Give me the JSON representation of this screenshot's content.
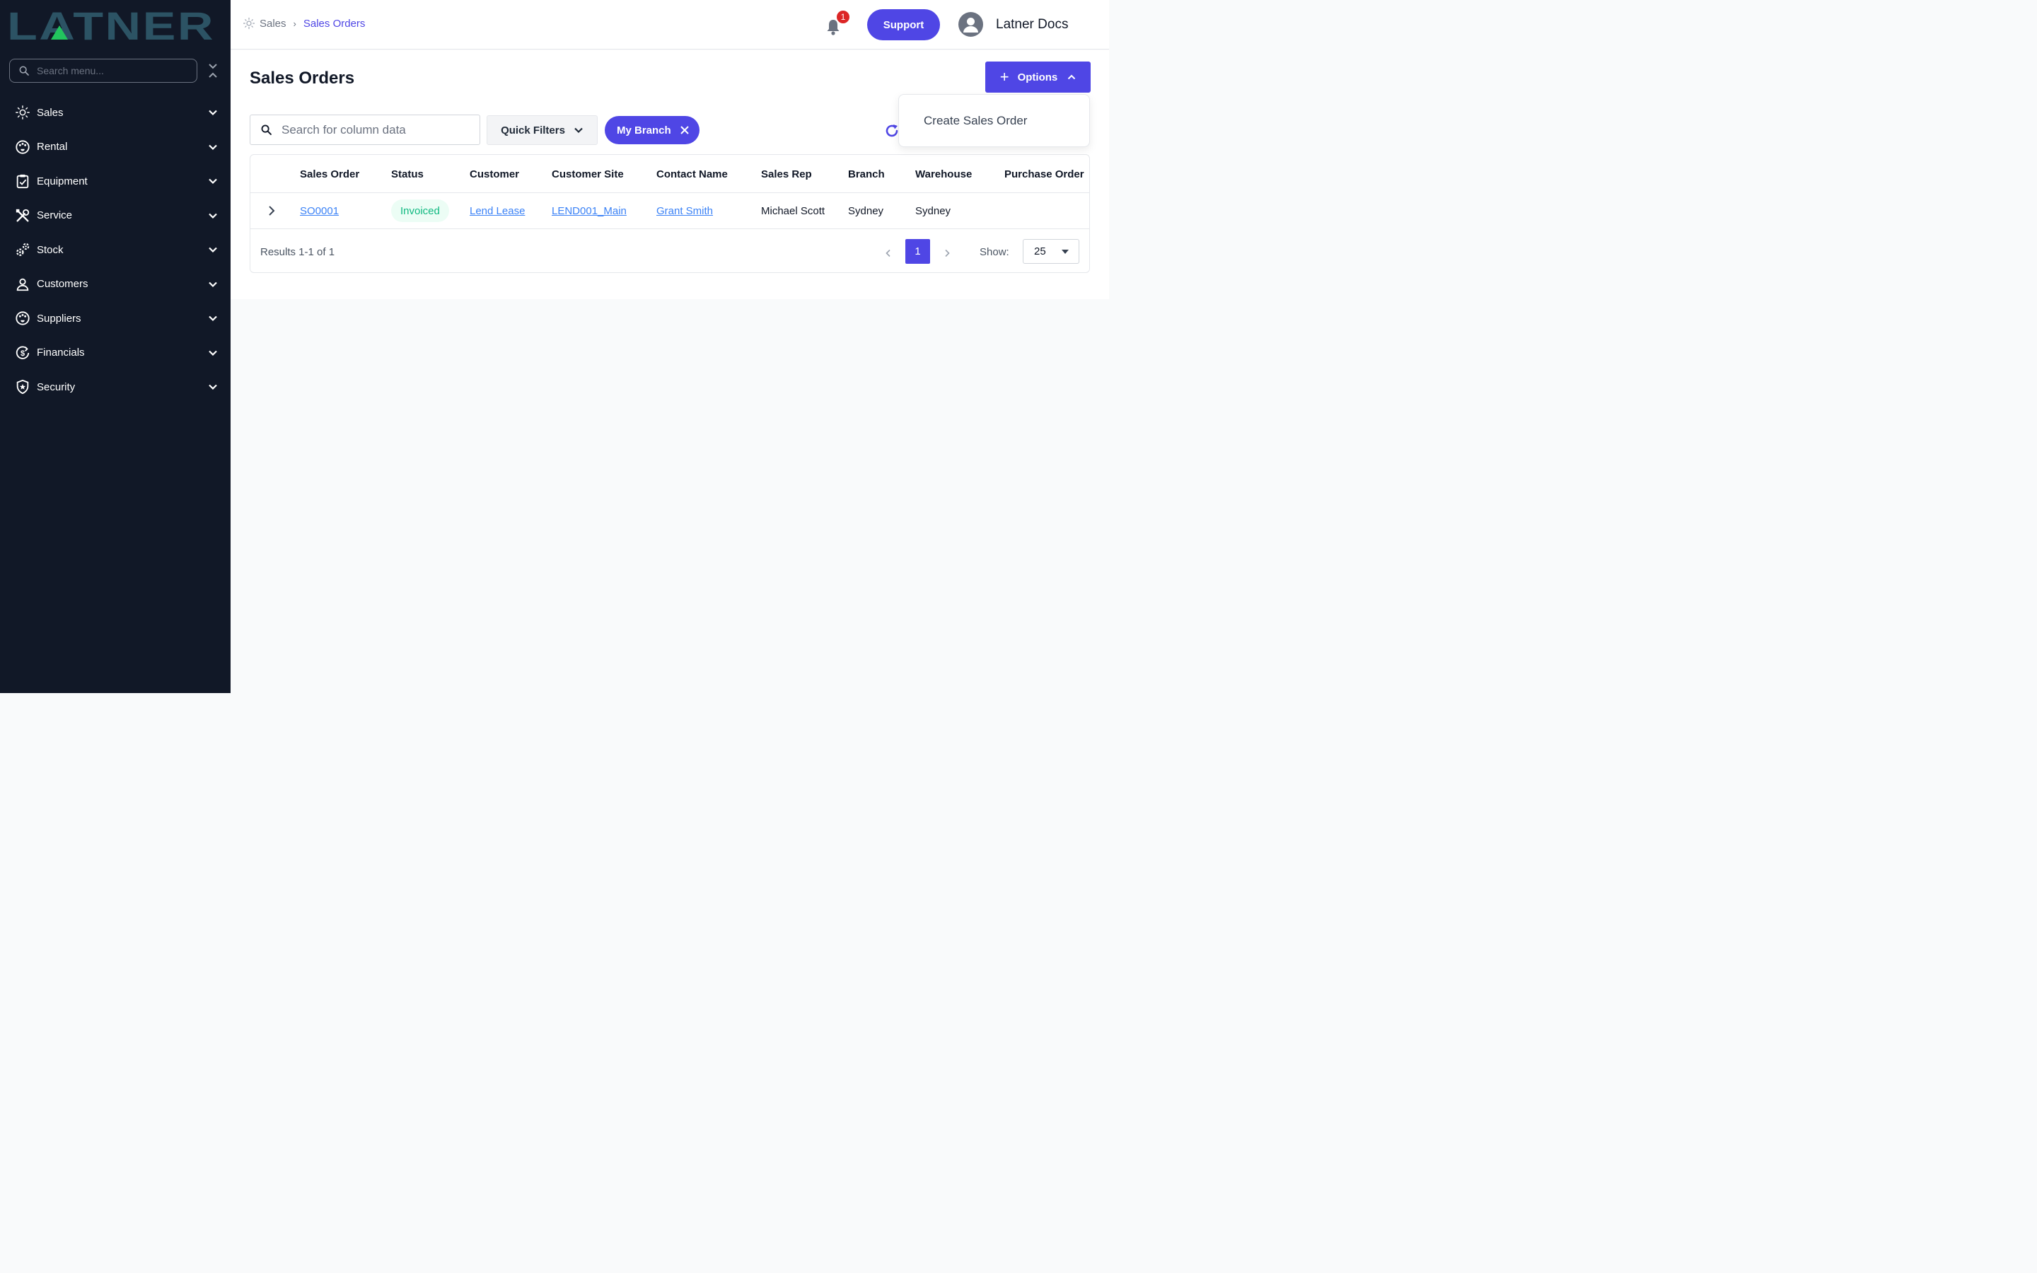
{
  "app": {
    "logo_text": "LATNER",
    "brand_color": "#4f46e5",
    "sidebar_bg": "#111827"
  },
  "sidebar": {
    "search_placeholder": "Search menu...",
    "items": [
      {
        "label": "Sales",
        "icon": "sales-sun-icon"
      },
      {
        "label": "Rental",
        "icon": "rental-palette-icon"
      },
      {
        "label": "Equipment",
        "icon": "clipboard-icon"
      },
      {
        "label": "Service",
        "icon": "tools-icon"
      },
      {
        "label": "Stock",
        "icon": "stock-gears-icon"
      },
      {
        "label": "Customers",
        "icon": "person-icon"
      },
      {
        "label": "Suppliers",
        "icon": "suppliers-palette-icon"
      },
      {
        "label": "Financials",
        "icon": "dollar-cycle-icon"
      },
      {
        "label": "Security",
        "icon": "shield-star-icon"
      }
    ]
  },
  "header": {
    "breadcrumb": [
      "Sales",
      "Sales Orders"
    ],
    "notification_count": "1",
    "support_label": "Support",
    "user_name": "Latner Docs"
  },
  "page": {
    "title": "Sales Orders",
    "options_label": "Options",
    "options_menu": [
      "Create Sales Order"
    ],
    "search_placeholder": "Search for column data",
    "quick_filters_label": "Quick Filters",
    "active_filter": "My Branch"
  },
  "table": {
    "columns": [
      "Sales Order",
      "Status",
      "Customer",
      "Customer Site",
      "Contact Name",
      "Sales Rep",
      "Branch",
      "Warehouse",
      "Purchase Order"
    ],
    "rows": [
      {
        "sales_order": "SO0001",
        "status": "Invoiced",
        "customer": "Lend Lease",
        "customer_site": "LEND001_Main",
        "contact_name": "Grant Smith",
        "sales_rep": "Michael Scott",
        "branch": "Sydney",
        "warehouse": "Sydney",
        "purchase_order": ""
      }
    ],
    "results_text": "Results 1-1 of 1",
    "current_page": "1",
    "show_label": "Show:",
    "page_size": "25"
  }
}
